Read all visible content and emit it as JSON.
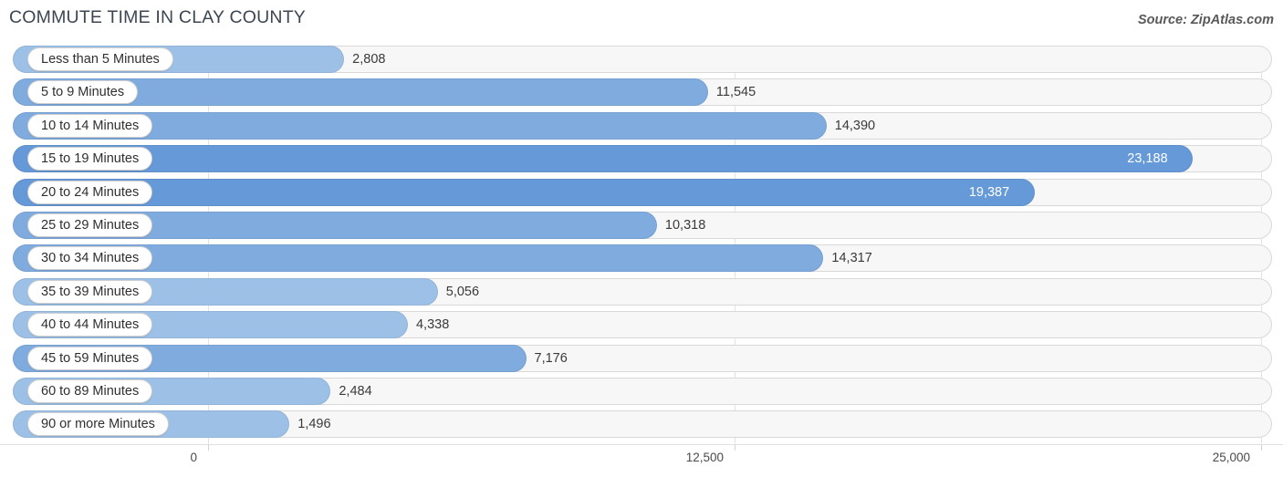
{
  "header": {
    "title": "COMMUTE TIME IN CLAY COUNTY",
    "source": "Source: ZipAtlas.com"
  },
  "axis": {
    "ticks": [
      "0",
      "12,500",
      "25,000"
    ],
    "tick_values": [
      0,
      12500,
      25000
    ]
  },
  "colors": {
    "bar_light": "#9dc0e6",
    "bar_mid": "#7fabdf",
    "bar_dark": "#6699d8",
    "track_fill": "#f7f7f7",
    "track_border": "#d9d9d9",
    "grid": "#e3e3e3",
    "title_text": "#3c4652",
    "value_text": "#3a3a3a",
    "value_text_inside": "#ffffff"
  },
  "chart_data": {
    "type": "bar",
    "orientation": "horizontal",
    "title": "COMMUTE TIME IN CLAY COUNTY",
    "xlabel": "",
    "ylabel": "",
    "xlim": [
      0,
      25000
    ],
    "grid": true,
    "legend": "none",
    "categories": [
      "Less than 5 Minutes",
      "5 to 9 Minutes",
      "10 to 14 Minutes",
      "15 to 19 Minutes",
      "20 to 24 Minutes",
      "25 to 29 Minutes",
      "30 to 34 Minutes",
      "35 to 39 Minutes",
      "40 to 44 Minutes",
      "45 to 59 Minutes",
      "60 to 89 Minutes",
      "90 or more Minutes"
    ],
    "values": [
      2808,
      11545,
      14390,
      23188,
      19387,
      10318,
      14317,
      5056,
      4338,
      7176,
      2484,
      1496
    ],
    "value_labels": [
      "2,808",
      "11,545",
      "14,390",
      "23,188",
      "19,387",
      "10,318",
      "14,317",
      "5,056",
      "4,338",
      "7,176",
      "2,484",
      "1,496"
    ]
  },
  "rows": [
    {
      "label": "Less than 5 Minutes",
      "value": 2808,
      "value_label": "2,808",
      "shade": "light",
      "label_inside": false
    },
    {
      "label": "5 to 9 Minutes",
      "value": 11545,
      "value_label": "11,545",
      "shade": "mid",
      "label_inside": false
    },
    {
      "label": "10 to 14 Minutes",
      "value": 14390,
      "value_label": "14,390",
      "shade": "mid",
      "label_inside": false
    },
    {
      "label": "15 to 19 Minutes",
      "value": 23188,
      "value_label": "23,188",
      "shade": "dark",
      "label_inside": true
    },
    {
      "label": "20 to 24 Minutes",
      "value": 19387,
      "value_label": "19,387",
      "shade": "dark",
      "label_inside": true
    },
    {
      "label": "25 to 29 Minutes",
      "value": 10318,
      "value_label": "10,318",
      "shade": "mid",
      "label_inside": false
    },
    {
      "label": "30 to 34 Minutes",
      "value": 14317,
      "value_label": "14,317",
      "shade": "mid",
      "label_inside": false
    },
    {
      "label": "35 to 39 Minutes",
      "value": 5056,
      "value_label": "5,056",
      "shade": "light",
      "label_inside": false
    },
    {
      "label": "40 to 44 Minutes",
      "value": 4338,
      "value_label": "4,338",
      "shade": "light",
      "label_inside": false
    },
    {
      "label": "45 to 59 Minutes",
      "value": 7176,
      "value_label": "7,176",
      "shade": "mid",
      "label_inside": false
    },
    {
      "label": "60 to 89 Minutes",
      "value": 2484,
      "value_label": "2,484",
      "shade": "light",
      "label_inside": false
    },
    {
      "label": "90 or more Minutes",
      "value": 1496,
      "value_label": "1,496",
      "shade": "light",
      "label_inside": false
    }
  ]
}
